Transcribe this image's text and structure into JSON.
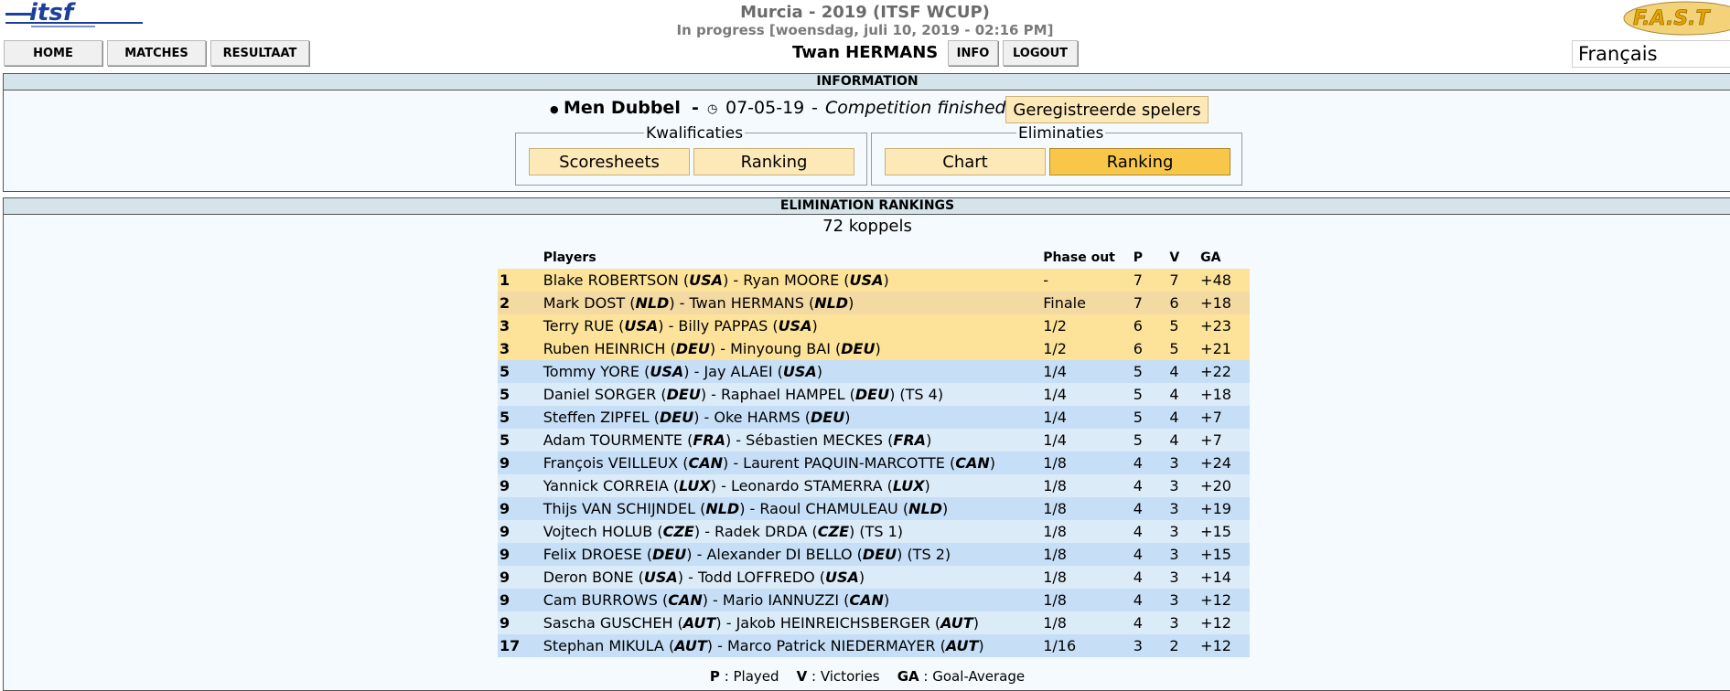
{
  "header": {
    "title": "Murcia - 2019 (ITSF WCUP)",
    "subtitle": "In progress [woensdag, juli 10, 2019 - 02:16 PM]",
    "logo_text": "itsf",
    "fast_logo_text": "F.A.S.T",
    "username": "Twan HERMANS",
    "language": "Français"
  },
  "nav": {
    "home": "HOME",
    "matches": "MATCHES",
    "results": "RESULTAAT",
    "info": "INFO",
    "logout": "LOGOUT"
  },
  "info_panel": {
    "title": "INFORMATION",
    "event_name": "Men Dubbel",
    "dash": "-",
    "date": "07-05-19",
    "date_sep": "-",
    "status": "Competition finished",
    "registered_button": "Geregistreerde spelers",
    "qualifications": {
      "legend": "Kwalificaties",
      "scoresheets": "Scoresheets",
      "ranking": "Ranking"
    },
    "eliminations": {
      "legend": "Eliminaties",
      "chart": "Chart",
      "ranking": "Ranking"
    }
  },
  "colors": {
    "gold_row": "#fde39a",
    "silver_row": "#f3d9a2",
    "blue_row_a": "#c6dff6",
    "blue_row_b": "#dcebf8",
    "active_button": "#f8c74a",
    "button": "#fde8b8"
  },
  "rankings": {
    "title": "ELIMINATION RANKINGS",
    "count": "72 koppels",
    "columns": {
      "players": "Players",
      "phase": "Phase out",
      "p": "P",
      "v": "V",
      "ga": "GA"
    },
    "rows": [
      {
        "pos": "1",
        "p1": "Blake ROBERTSON",
        "c1": "USA",
        "p2": "Ryan MOORE",
        "c2": "USA",
        "seed": "",
        "phase": "-",
        "p": "7",
        "v": "7",
        "ga": "+48"
      },
      {
        "pos": "2",
        "p1": "Mark DOST",
        "c1": "NLD",
        "p2": "Twan HERMANS",
        "c2": "NLD",
        "seed": "",
        "phase": "Finale",
        "p": "7",
        "v": "6",
        "ga": "+18"
      },
      {
        "pos": "3",
        "p1": "Terry RUE",
        "c1": "USA",
        "p2": "Billy PAPPAS",
        "c2": "USA",
        "seed": "",
        "phase": "1/2",
        "p": "6",
        "v": "5",
        "ga": "+23"
      },
      {
        "pos": "3",
        "p1": "Ruben HEINRICH",
        "c1": "DEU",
        "p2": "Minyoung BAI",
        "c2": "DEU",
        "seed": "",
        "phase": "1/2",
        "p": "6",
        "v": "5",
        "ga": "+21"
      },
      {
        "pos": "5",
        "p1": "Tommy YORE",
        "c1": "USA",
        "p2": "Jay ALAEI",
        "c2": "USA",
        "seed": "",
        "phase": "1/4",
        "p": "5",
        "v": "4",
        "ga": "+22"
      },
      {
        "pos": "5",
        "p1": "Daniel SORGER",
        "c1": "DEU",
        "p2": "Raphael HAMPEL",
        "c2": "DEU",
        "seed": "(TS 4)",
        "phase": "1/4",
        "p": "5",
        "v": "4",
        "ga": "+18"
      },
      {
        "pos": "5",
        "p1": "Steffen ZIPFEL",
        "c1": "DEU",
        "p2": "Oke HARMS",
        "c2": "DEU",
        "seed": "",
        "phase": "1/4",
        "p": "5",
        "v": "4",
        "ga": "+7"
      },
      {
        "pos": "5",
        "p1": "Adam TOURMENTE",
        "c1": "FRA",
        "p2": "Sébastien MECKES",
        "c2": "FRA",
        "seed": "",
        "phase": "1/4",
        "p": "5",
        "v": "4",
        "ga": "+7"
      },
      {
        "pos": "9",
        "p1": "François VEILLEUX",
        "c1": "CAN",
        "p2": "Laurent PAQUIN-MARCOTTE",
        "c2": "CAN",
        "seed": "",
        "phase": "1/8",
        "p": "4",
        "v": "3",
        "ga": "+24"
      },
      {
        "pos": "9",
        "p1": "Yannick CORREIA",
        "c1": "LUX",
        "p2": "Leonardo STAMERRA",
        "c2": "LUX",
        "seed": "",
        "phase": "1/8",
        "p": "4",
        "v": "3",
        "ga": "+20"
      },
      {
        "pos": "9",
        "p1": "Thijs VAN SCHIJNDEL",
        "c1": "NLD",
        "p2": "Raoul CHAMULEAU",
        "c2": "NLD",
        "seed": "",
        "phase": "1/8",
        "p": "4",
        "v": "3",
        "ga": "+19"
      },
      {
        "pos": "9",
        "p1": "Vojtech HOLUB",
        "c1": "CZE",
        "p2": "Radek DRDA",
        "c2": "CZE",
        "seed": "(TS 1)",
        "phase": "1/8",
        "p": "4",
        "v": "3",
        "ga": "+15"
      },
      {
        "pos": "9",
        "p1": "Felix DROESE",
        "c1": "DEU",
        "p2": "Alexander DI BELLO",
        "c2": "DEU",
        "seed": "(TS 2)",
        "phase": "1/8",
        "p": "4",
        "v": "3",
        "ga": "+15"
      },
      {
        "pos": "9",
        "p1": "Deron BONE",
        "c1": "USA",
        "p2": "Todd LOFFREDO",
        "c2": "USA",
        "seed": "",
        "phase": "1/8",
        "p": "4",
        "v": "3",
        "ga": "+14"
      },
      {
        "pos": "9",
        "p1": "Cam BURROWS",
        "c1": "CAN",
        "p2": "Mario IANNUZZI",
        "c2": "CAN",
        "seed": "",
        "phase": "1/8",
        "p": "4",
        "v": "3",
        "ga": "+12"
      },
      {
        "pos": "9",
        "p1": "Sascha GUSCHEH",
        "c1": "AUT",
        "p2": "Jakob HEINREICHSBERGER",
        "c2": "AUT",
        "seed": "",
        "phase": "1/8",
        "p": "4",
        "v": "3",
        "ga": "+12"
      },
      {
        "pos": "17",
        "p1": "Stephan MIKULA",
        "c1": "AUT",
        "p2": "Marco Patrick NIEDERMAYER",
        "c2": "AUT",
        "seed": "",
        "phase": "1/16",
        "p": "3",
        "v": "2",
        "ga": "+12"
      }
    ],
    "legend": {
      "p_key": "P",
      "p_label": ": Played",
      "v_key": "V",
      "v_label": ": Victories",
      "ga_key": "GA",
      "ga_label": ": Goal-Average"
    }
  }
}
